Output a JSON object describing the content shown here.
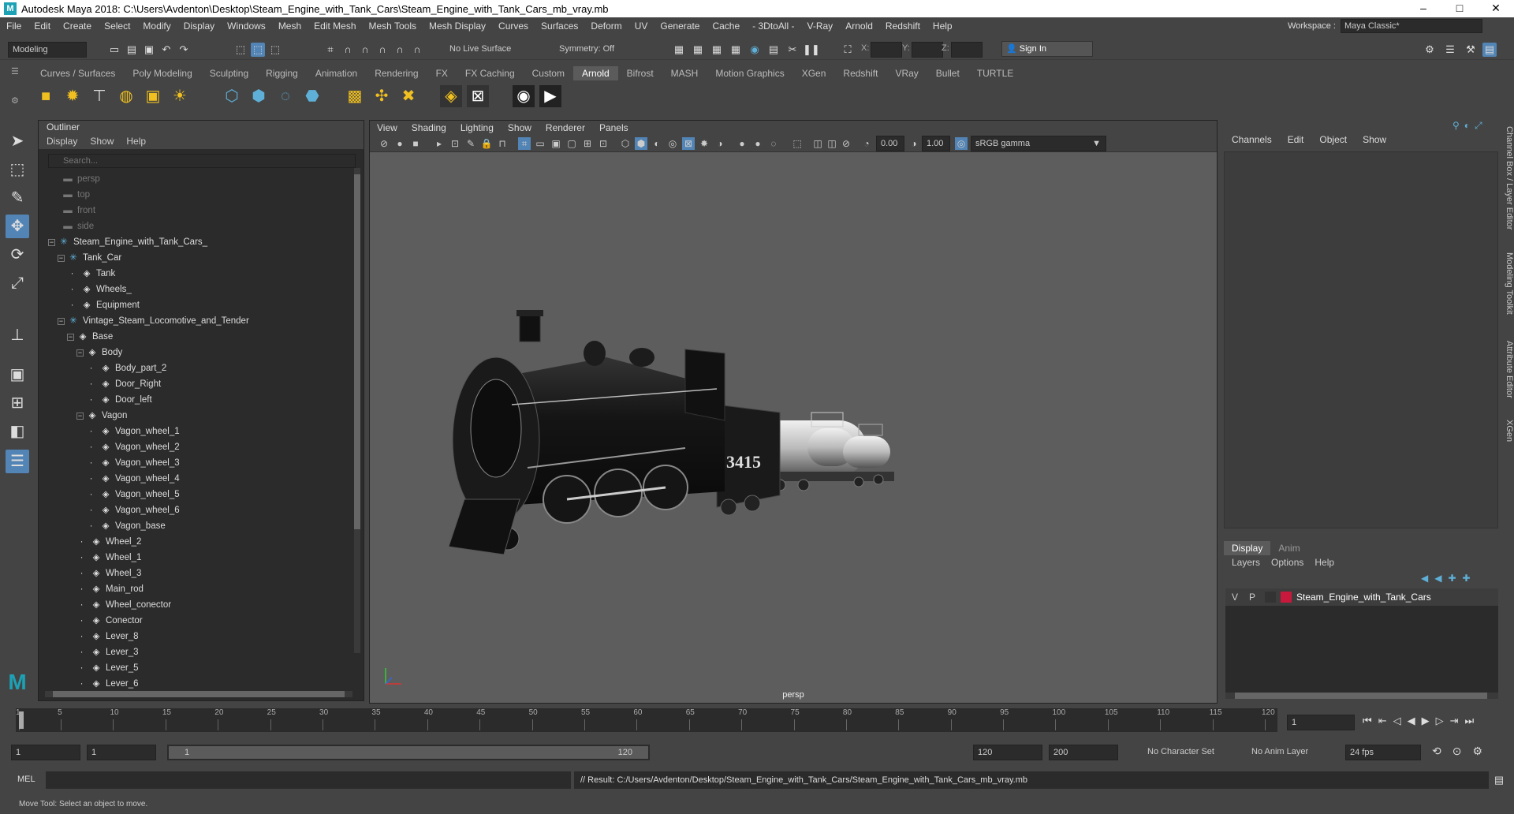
{
  "window": {
    "title": "Autodesk Maya 2018: C:\\Users\\Avdenton\\Desktop\\Steam_Engine_with_Tank_Cars\\Steam_Engine_with_Tank_Cars_mb_vray.mb",
    "min": "–",
    "max": "□",
    "close": "✕"
  },
  "menubar": [
    "File",
    "Edit",
    "Create",
    "Select",
    "Modify",
    "Display",
    "Windows",
    "Mesh",
    "Edit Mesh",
    "Mesh Tools",
    "Mesh Display",
    "Curves",
    "Surfaces",
    "Deform",
    "UV",
    "Generate",
    "Cache",
    "- 3DtoAll -",
    "V-Ray",
    "Arnold",
    "Redshift",
    "Help"
  ],
  "workspace": {
    "label": "Workspace :",
    "value": "Maya Classic*"
  },
  "statusline": {
    "mode": "Modeling",
    "live_surface": "No Live Surface",
    "symmetry": "Symmetry: Off",
    "x_label": "X:",
    "y_label": "Y:",
    "z_label": "Z:",
    "sign_in": "Sign In"
  },
  "shelf_tabs": [
    "Curves / Surfaces",
    "Poly Modeling",
    "Sculpting",
    "Rigging",
    "Animation",
    "Rendering",
    "FX",
    "FX Caching",
    "Custom",
    "Arnold",
    "Bifrost",
    "MASH",
    "Motion Graphics",
    "XGen",
    "Redshift",
    "VRay",
    "Bullet",
    "TURTLE"
  ],
  "shelf_active": "Arnold",
  "outliner": {
    "title": "Outliner",
    "menu": [
      "Display",
      "Show",
      "Help"
    ],
    "search_placeholder": "Search...",
    "items": [
      {
        "label": "persp",
        "depth": 0,
        "kind": "camera",
        "dim": true
      },
      {
        "label": "top",
        "depth": 0,
        "kind": "camera",
        "dim": true
      },
      {
        "label": "front",
        "depth": 0,
        "kind": "camera",
        "dim": true
      },
      {
        "label": "side",
        "depth": 0,
        "kind": "camera",
        "dim": true
      },
      {
        "label": "Steam_Engine_with_Tank_Cars_",
        "depth": 0,
        "kind": "group",
        "exp": "−"
      },
      {
        "label": "Tank_Car",
        "depth": 1,
        "kind": "group",
        "exp": "−"
      },
      {
        "label": "Tank",
        "depth": 2,
        "kind": "mesh"
      },
      {
        "label": "Wheels_",
        "depth": 2,
        "kind": "mesh"
      },
      {
        "label": "Equipment",
        "depth": 2,
        "kind": "mesh"
      },
      {
        "label": "Vintage_Steam_Locomotive_and_Tender",
        "depth": 1,
        "kind": "group",
        "exp": "−"
      },
      {
        "label": "Base",
        "depth": 2,
        "kind": "mesh",
        "exp": "−"
      },
      {
        "label": "Body",
        "depth": 3,
        "kind": "mesh",
        "exp": "−"
      },
      {
        "label": "Body_part_2",
        "depth": 4,
        "kind": "mesh"
      },
      {
        "label": "Door_Right",
        "depth": 4,
        "kind": "mesh"
      },
      {
        "label": "Door_left",
        "depth": 4,
        "kind": "mesh"
      },
      {
        "label": "Vagon",
        "depth": 3,
        "kind": "mesh",
        "exp": "−"
      },
      {
        "label": "Vagon_wheel_1",
        "depth": 4,
        "kind": "mesh"
      },
      {
        "label": "Vagon_wheel_2",
        "depth": 4,
        "kind": "mesh"
      },
      {
        "label": "Vagon_wheel_3",
        "depth": 4,
        "kind": "mesh"
      },
      {
        "label": "Vagon_wheel_4",
        "depth": 4,
        "kind": "mesh"
      },
      {
        "label": "Vagon_wheel_5",
        "depth": 4,
        "kind": "mesh"
      },
      {
        "label": "Vagon_wheel_6",
        "depth": 4,
        "kind": "mesh"
      },
      {
        "label": "Vagon_base",
        "depth": 4,
        "kind": "mesh"
      },
      {
        "label": "Wheel_2",
        "depth": 3,
        "kind": "mesh"
      },
      {
        "label": "Wheel_1",
        "depth": 3,
        "kind": "mesh"
      },
      {
        "label": "Wheel_3",
        "depth": 3,
        "kind": "mesh"
      },
      {
        "label": "Main_rod",
        "depth": 3,
        "kind": "mesh"
      },
      {
        "label": "Wheel_conector",
        "depth": 3,
        "kind": "mesh"
      },
      {
        "label": "Conector",
        "depth": 3,
        "kind": "mesh"
      },
      {
        "label": "Lever_8",
        "depth": 3,
        "kind": "mesh"
      },
      {
        "label": "Lever_3",
        "depth": 3,
        "kind": "mesh"
      },
      {
        "label": "Lever_5",
        "depth": 3,
        "kind": "mesh"
      },
      {
        "label": "Lever_6",
        "depth": 3,
        "kind": "mesh"
      }
    ]
  },
  "viewport": {
    "menu": [
      "View",
      "Shading",
      "Lighting",
      "Show",
      "Renderer",
      "Panels"
    ],
    "field1": "0.00",
    "field2": "1.00",
    "color_mgmt": "sRGB gamma",
    "camera_label": "persp",
    "loco_number": "3415"
  },
  "channel_box": {
    "menu": [
      "Channels",
      "Edit",
      "Object",
      "Show"
    ]
  },
  "side_tabs": [
    "Channel Box / Layer Editor",
    "Modeling Toolkit",
    "Attribute Editor",
    "XGen"
  ],
  "layer_editor": {
    "tabs": [
      "Display",
      "Anim"
    ],
    "menu": [
      "Layers",
      "Options",
      "Help"
    ],
    "layer": {
      "v": "V",
      "p": "P",
      "name": "Steam_Engine_with_Tank_Cars",
      "color": "#c8193c"
    }
  },
  "timeline": {
    "ticks": [
      "1",
      "5",
      "10",
      "15",
      "20",
      "25",
      "30",
      "35",
      "40",
      "45",
      "50",
      "55",
      "60",
      "65",
      "70",
      "75",
      "80",
      "85",
      "90",
      "95",
      "100",
      "105",
      "110",
      "115",
      "120"
    ],
    "current_frame": "1"
  },
  "range": {
    "start": "1",
    "start2": "1",
    "slider_start": "1",
    "slider_end": "120",
    "end": "120",
    "end2": "200",
    "char_set": "No Character Set",
    "anim_layer": "No Anim Layer",
    "fps": "24 fps"
  },
  "command": {
    "label": "MEL",
    "result": "// Result: C:/Users/Avdenton/Desktop/Steam_Engine_with_Tank_Cars/Steam_Engine_with_Tank_Cars_mb_vray.mb"
  },
  "help_line": "Move Tool: Select an object to move."
}
